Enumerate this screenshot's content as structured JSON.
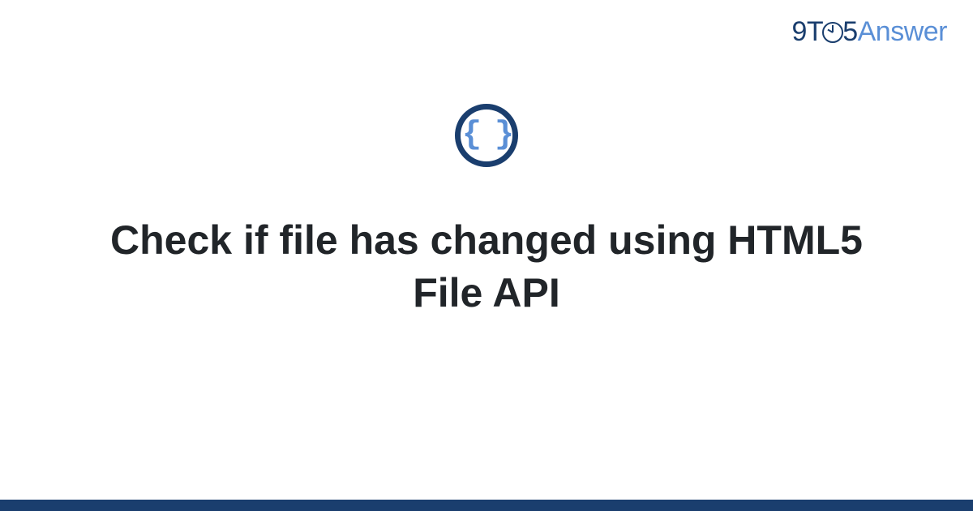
{
  "logo": {
    "part1": "9T",
    "part2": "5",
    "part3": "Answer"
  },
  "icon": {
    "glyph": "{ }",
    "name": "code-braces-icon"
  },
  "title": "Check if file has changed using HTML5 File API",
  "colors": {
    "brand_dark": "#1a3e6e",
    "brand_light": "#5a8fd6",
    "text": "#212529"
  }
}
